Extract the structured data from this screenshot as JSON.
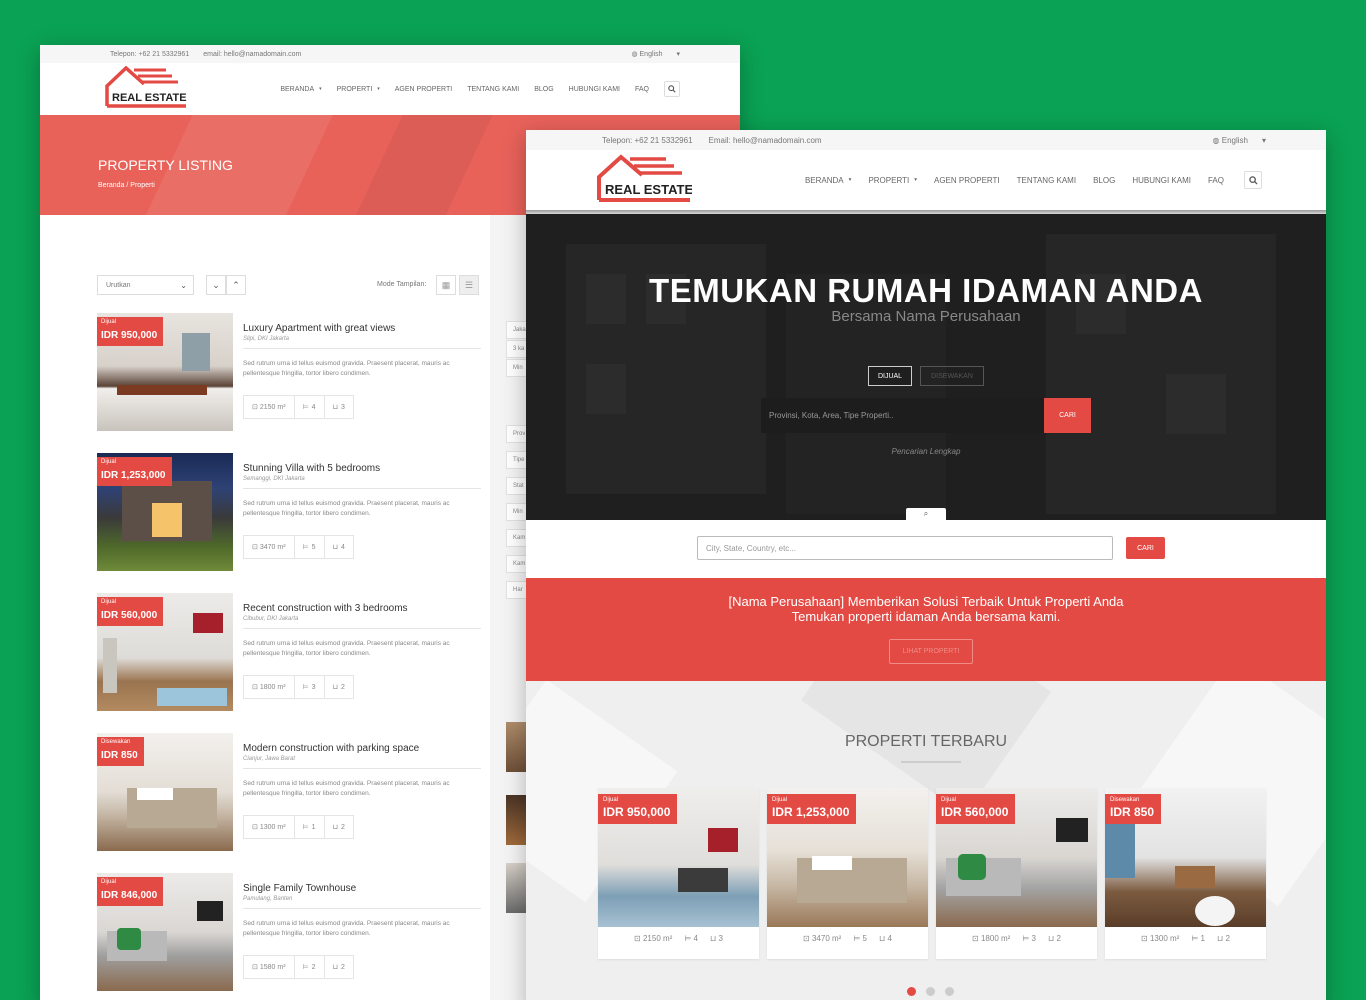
{
  "brand": {
    "name": "REAL ESTATE",
    "accent": "#e34a44",
    "background": "#0aa254"
  },
  "topbar": {
    "phone": "Telepon: +62 21 5332961",
    "email": "email: hello@namadomain.com",
    "email_front": "Email: hello@namadomain.com",
    "language": "English",
    "language_icon": "globe-icon"
  },
  "nav": {
    "items": [
      "BERANDA",
      "PROPERTI",
      "AGEN PROPERTI",
      "TENTANG KAMI",
      "BLOG",
      "HUBUNGI KAMI",
      "FAQ"
    ]
  },
  "listing_page": {
    "title": "PROPERTY LISTING",
    "breadcrumb": "Beranda / Properti",
    "sort_label": "Urutkan",
    "view_mode_label": "Mode Tampilan:",
    "description": "Sed rutrum urna id tellus euismod gravida. Praesent placerat, mauris ac pellentesque fringilla, tortor libero condimen.",
    "listings": [
      {
        "status": "Dijual",
        "price": "IDR 950,000",
        "title": "Luxury Apartment with great views",
        "location": "Slipi, DKI Jakarta",
        "area": "2150 m²",
        "beds": "4",
        "baths": "3"
      },
      {
        "status": "Dijual",
        "price": "IDR 1,253,000",
        "title": "Stunning Villa with 5 bedrooms",
        "location": "Semanggi, DKI Jakarta",
        "area": "3470 m²",
        "beds": "5",
        "baths": "4"
      },
      {
        "status": "Dijual",
        "price": "IDR 560,000",
        "title": "Recent construction with 3 bedrooms",
        "location": "Cibubur, DKI Jakarta",
        "area": "1800 m²",
        "beds": "3",
        "baths": "2"
      },
      {
        "status": "Disewakan",
        "price": "IDR 850",
        "title": "Modern construction with parking space",
        "location": "Cianjur, Jawa Barat",
        "area": "1300 m²",
        "beds": "1",
        "baths": "2"
      },
      {
        "status": "Dijual",
        "price": "IDR 846,000",
        "title": "Single Family Townhouse",
        "location": "Pamulang, Banten",
        "area": "1580 m²",
        "beds": "2",
        "baths": "2"
      }
    ],
    "sidebar_fields": [
      "Jaka",
      "3 ka",
      "Min",
      "Prov",
      "Tipe",
      "Stat",
      "Min",
      "Kam",
      "Kam",
      "Har"
    ]
  },
  "home_page": {
    "hero_title": "TEMUKAN RUMAH IDAMAN ANDA",
    "hero_subtitle": "Bersama Nama Perusahaan",
    "tabs": [
      "DIJUAL",
      "DISEWAKAN"
    ],
    "hero_search_placeholder": "Provinsi, Kota, Area, Tipe Properti..",
    "search_button": "CARI",
    "advanced_search": "Pencarian Lengkap",
    "quick_search_placeholder": "City, State, Country, etc...",
    "cta_line1": "[Nama Perusahaan] Memberikan Solusi Terbaik Untuk Properti Anda",
    "cta_line2": "Temukan properti idaman Anda bersama kami.",
    "cta_button": "LIHAT PROPERTI",
    "recent_title": "PROPERTI TERBARU",
    "cards": [
      {
        "status": "Dijual",
        "price": "IDR 950,000",
        "area": "2150 m²",
        "beds": "4",
        "baths": "3"
      },
      {
        "status": "Dijual",
        "price": "IDR 1,253,000",
        "area": "3470 m²",
        "beds": "5",
        "baths": "4"
      },
      {
        "status": "Dijual",
        "price": "IDR 560,000",
        "area": "1800 m²",
        "beds": "3",
        "baths": "2"
      },
      {
        "status": "Disewakan",
        "price": "IDR 850",
        "area": "1300 m²",
        "beds": "1",
        "baths": "2"
      }
    ],
    "carousel": {
      "pages": 3,
      "active": 1
    }
  }
}
